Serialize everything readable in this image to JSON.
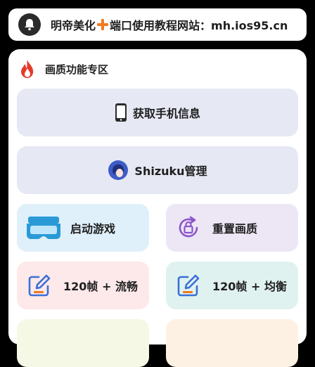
{
  "banner": {
    "text_left": "明帝美化",
    "text_right": "端口使用教程网站：mh.ios95.cn",
    "icon": "bell-icon",
    "accent": "#f07a22"
  },
  "section": {
    "title": "画质功能专区",
    "icon": "fire-icon"
  },
  "buttons": {
    "phone_info": "获取手机信息",
    "shizuku": "Shizuku管理"
  },
  "tiles": {
    "launch_game": "启动游戏",
    "reset_quality": "重置画质",
    "fps_smooth": "120帧 + 流畅",
    "fps_other": "120帧 + 均衡"
  },
  "colors": {
    "launch_bg": "#dff0fb",
    "reset_bg": "#ece6f5",
    "fps_smooth_bg": "#fde8ea",
    "fps_other_bg": "#e0f2ef",
    "wide_bg": "#e6e8f4"
  }
}
